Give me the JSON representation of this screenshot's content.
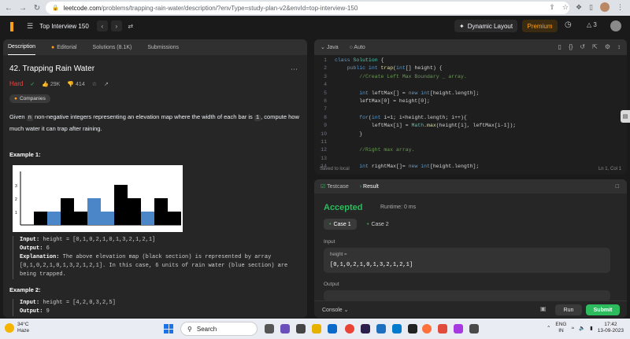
{
  "browser": {
    "url_host": "leetcode.com",
    "url_path": "/problems/trapping-rain-water/description/?envType=study-plan-v2&envId=top-interview-150"
  },
  "nav": {
    "list_title": "Top Interview 150",
    "dynamic_layout": "Dynamic Layout",
    "premium": "Premium",
    "streak": "3"
  },
  "left": {
    "tabs": [
      "Description",
      "Editorial",
      "Solutions (8.1K)",
      "Submissions"
    ],
    "title": "42. Trapping Rain Water",
    "difficulty": "Hard",
    "likes": "29K",
    "dislikes": "414",
    "companies": "Companies",
    "desc_pre": "Given ",
    "desc_n": "n",
    "desc_mid": " non-negative integers representing an elevation map where the width of each bar is ",
    "desc_one": "1",
    "desc_post": ", compute how much water it can trap after raining.",
    "example1_title": "Example 1:",
    "example1": {
      "input_label": "Input:",
      "input": " height = [0,1,0,2,1,0,1,3,2,1,2,1]",
      "output_label": "Output:",
      "output": " 6",
      "explanation_label": "Explanation:",
      "explanation": " The above elevation map (black section) is represented by array [0,1,0,2,1,0,1,3,2,1,2,1]. In this case, 6 units of rain water (blue section) are being trapped."
    },
    "example2_title": "Example 2:",
    "example2": {
      "input_label": "Input:",
      "input": " height = [4,2,0,3,2,5]",
      "output_label": "Output:",
      "output": " 9"
    },
    "chart_ticks": [
      "3",
      "2",
      "1"
    ]
  },
  "editor": {
    "language": "Java",
    "mode": "Auto",
    "saved": "Saved to local",
    "position": "Ln 1, Col 1",
    "line_numbers": [
      "1",
      "2",
      "3",
      "4",
      "5",
      "6",
      "7",
      "8",
      "9",
      "10",
      "11",
      "12",
      "13",
      "14"
    ]
  },
  "result": {
    "tabs": [
      "Testcase",
      "Result"
    ],
    "status": "Accepted",
    "runtime": "Runtime: 0 ms",
    "case1": "Case 1",
    "case2": "Case 2",
    "input_label": "Input",
    "param_label": "height =",
    "param_value": "[0,1,0,2,1,0,1,3,2,1,2,1]",
    "output_label": "Output",
    "console": "Console",
    "run": "Run",
    "submit": "Submit"
  },
  "taskbar": {
    "temp": "34°C",
    "weather": "Haze",
    "search": "Search",
    "lang1": "ENG",
    "lang2": "IN",
    "time": "17:42",
    "date": "13-09-2023"
  }
}
